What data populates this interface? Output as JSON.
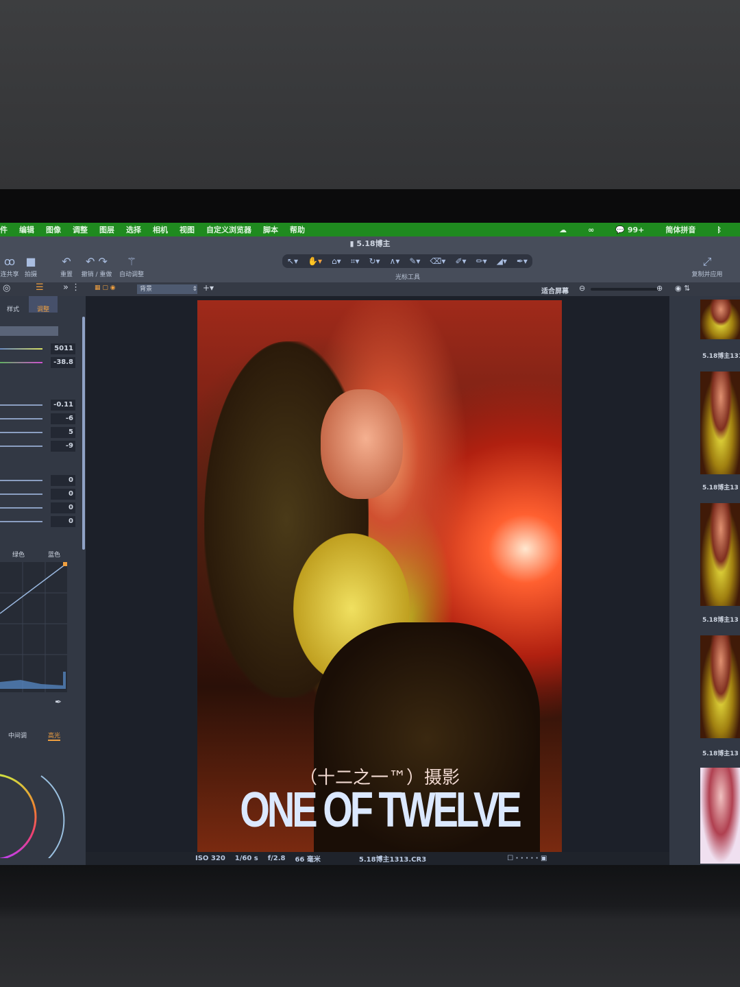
{
  "menu": [
    "件",
    "编辑",
    "图像",
    "调整",
    "图层",
    "选择",
    "相机",
    "视图",
    "自定义浏览器",
    "脚本",
    "帮助"
  ],
  "menu_right": {
    "badge": "99+",
    "input_method": "简体拼音"
  },
  "window_title": "5.18博主",
  "toolbar": {
    "share": "连共享",
    "capture": "拍摄",
    "reset": "重置",
    "undo_redo": "撤销 / 重做",
    "auto_adjust": "自动调整",
    "cursor_tools": "光标工具",
    "copy_apply": "复制并应用"
  },
  "subbar": {
    "layer": "背景",
    "fit": "适合屏幕"
  },
  "left_tabs": {
    "style": "样式",
    "adjust": "调整"
  },
  "white_balance": {
    "kelvin": "5011",
    "tint": "-38.8"
  },
  "exposure_values": [
    "-0.11",
    "-6",
    "5",
    "-9"
  ],
  "hdr_values": [
    "0",
    "0",
    "0",
    "0"
  ],
  "curve_tabs": [
    "绿色",
    "蓝色"
  ],
  "color_balance_tabs": {
    "midtones": "中间调",
    "highlights": "高光"
  },
  "photo": {
    "subtitle": "（十二之一™）摄影",
    "title": "ONE OF TWELVE"
  },
  "status": {
    "iso": "ISO 320",
    "shutter": "1/60 s",
    "aperture": "f/2.8",
    "focal": "66 毫米",
    "filename": "5.18博主1313.CR3"
  },
  "thumbnails": [
    "5.18博主131",
    "5.18博主13",
    "5.18博主13",
    "5.18博主13"
  ]
}
